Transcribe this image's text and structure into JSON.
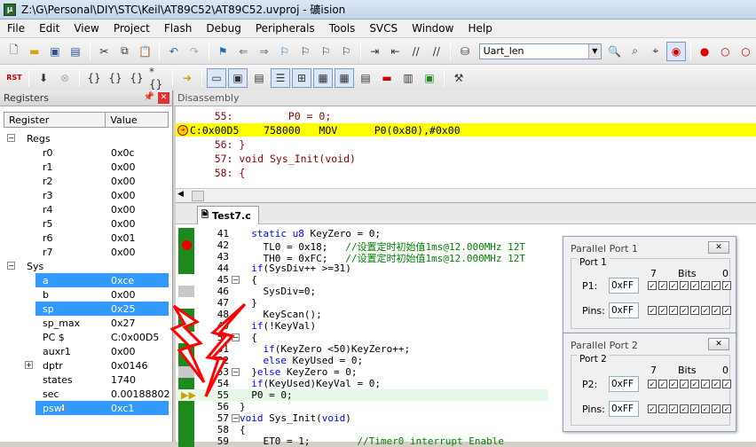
{
  "window": {
    "title": "Z:\\G\\Personal\\DIY\\STC\\Keil\\AT89C52\\AT89C52.uvproj - 礦ision",
    "app_icon": "keil-icon"
  },
  "menu": [
    "File",
    "Edit",
    "View",
    "Project",
    "Flash",
    "Debug",
    "Peripherals",
    "Tools",
    "SVCS",
    "Window",
    "Help"
  ],
  "toolbar": {
    "target_combo": "Uart_len"
  },
  "registers_panel": {
    "title": "Registers",
    "columns": [
      "Register",
      "Value"
    ],
    "groups": [
      {
        "name": "Regs",
        "items": [
          {
            "name": "r0",
            "value": "0x0c"
          },
          {
            "name": "r1",
            "value": "0x00"
          },
          {
            "name": "r2",
            "value": "0x00"
          },
          {
            "name": "r3",
            "value": "0x00"
          },
          {
            "name": "r4",
            "value": "0x00"
          },
          {
            "name": "r5",
            "value": "0x00"
          },
          {
            "name": "r6",
            "value": "0x01"
          },
          {
            "name": "r7",
            "value": "0x00"
          }
        ]
      },
      {
        "name": "Sys",
        "items": [
          {
            "name": "a",
            "value": "0xce"
          },
          {
            "name": "b",
            "value": "0x00"
          },
          {
            "name": "sp",
            "value": "0x25"
          },
          {
            "name": "sp_max",
            "value": "0x27"
          },
          {
            "name": "PC  $",
            "value": "C:0x00D5"
          },
          {
            "name": "auxr1",
            "value": "0x00"
          },
          {
            "name": "dptr",
            "value": "0x0146"
          },
          {
            "name": "states",
            "value": "1740"
          },
          {
            "name": "sec",
            "value": "0.00188802"
          },
          {
            "name": "psw",
            "value": "0xc1"
          }
        ]
      }
    ]
  },
  "disassembly": {
    "title": "Disassembly",
    "lines": [
      {
        "text": "    55:         P0 = 0;",
        "current": false
      },
      {
        "text": "C:0x00D5    758000   MOV      P0(0x80),#0x00",
        "current": true
      },
      {
        "text": "    56: }",
        "current": false
      },
      {
        "text": "    57: void Sys_Init(void)",
        "current": false
      },
      {
        "text": "    58: {",
        "current": false
      }
    ]
  },
  "editor": {
    "tab": "Test7.c",
    "lines": [
      {
        "n": "41",
        "code": "  static u8 KeyZero = 0;"
      },
      {
        "n": "42",
        "code": "    TL0 = 0x18;   //设置定时初始值1ms@12.000MHz 12T"
      },
      {
        "n": "43",
        "code": "    TH0 = 0xFC;   //设置定时初始值1ms@12.000MHz 12T"
      },
      {
        "n": "44",
        "code": "  if(SysDiv++ >=31)"
      },
      {
        "n": "45",
        "code": "  {"
      },
      {
        "n": "46",
        "code": "    SysDiv=0;"
      },
      {
        "n": "47",
        "code": "  }"
      },
      {
        "n": "48",
        "code": "    KeyScan();"
      },
      {
        "n": "49",
        "code": "  if(!KeyVal)"
      },
      {
        "n": "50",
        "code": "  {"
      },
      {
        "n": "51",
        "code": "    if(KeyZero <50)KeyZero++;"
      },
      {
        "n": "52",
        "code": "    else KeyUsed = 0;"
      },
      {
        "n": "53",
        "code": "  }else KeyZero = 0;"
      },
      {
        "n": "54",
        "code": "  if(KeyUsed)KeyVal = 0;"
      },
      {
        "n": "55",
        "code": "  P0 = 0;"
      },
      {
        "n": "56",
        "code": "}"
      },
      {
        "n": "57",
        "code": "void Sys_Init(void)"
      },
      {
        "n": "58",
        "code": "{"
      },
      {
        "n": "59",
        "code": "    ET0 = 1;        //Timer0 interrupt Enable"
      }
    ]
  },
  "port1": {
    "title": "Parallel Port 1",
    "group": "Port 1",
    "label_bits": "Bits",
    "bit_hi": "7",
    "bit_lo": "0",
    "p_label": "P1:",
    "p_value": "0xFF",
    "pins_label": "Pins:",
    "pins_value": "0xFF"
  },
  "port2": {
    "title": "Parallel Port 2",
    "group": "Port 2",
    "label_bits": "Bits",
    "bit_hi": "7",
    "bit_lo": "0",
    "p_label": "P2:",
    "p_value": "0xFF",
    "pins_label": "Pins:",
    "pins_value": "0xFF"
  },
  "colors": {
    "current_line": "#ffff00",
    "selection": "#3399ff",
    "coverage": "#1d8a1d",
    "annotation": "#ff0000"
  }
}
